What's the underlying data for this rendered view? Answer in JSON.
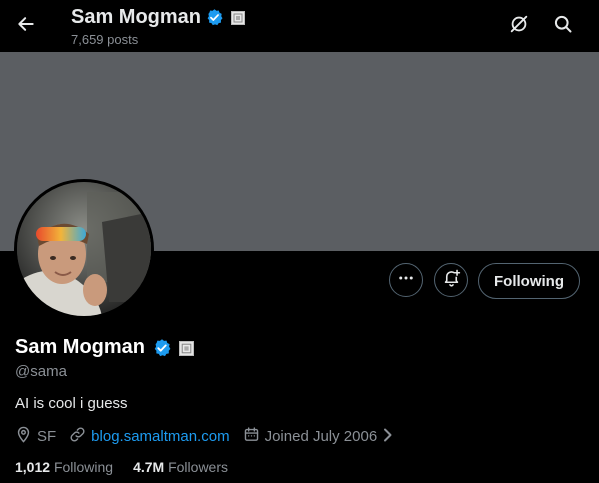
{
  "header": {
    "name": "Sam Mogman",
    "posts": "7,659 posts",
    "icons": [
      "back-arrow-icon",
      "verified-badge-icon",
      "affiliate-badge-icon",
      "creator-icon",
      "search-icon"
    ]
  },
  "profile": {
    "name": "Sam Mogman",
    "handle": "@sama",
    "bio": "AI is cool i guess",
    "location": "SF",
    "website": "blog.samaltman.com",
    "joined": "Joined July 2006",
    "following_count": "1,012",
    "following_label": "Following",
    "followers_count": "4.7M",
    "followers_label": "Followers"
  },
  "actions": {
    "following_button": "Following",
    "icons": [
      "more-icon",
      "notification-subscribe-icon"
    ]
  },
  "colors": {
    "background": "#000000",
    "banner": "#5b5e62",
    "verified": "#1d9bf0",
    "link": "#1d9bf0",
    "secondary_text": "#8b9096"
  }
}
